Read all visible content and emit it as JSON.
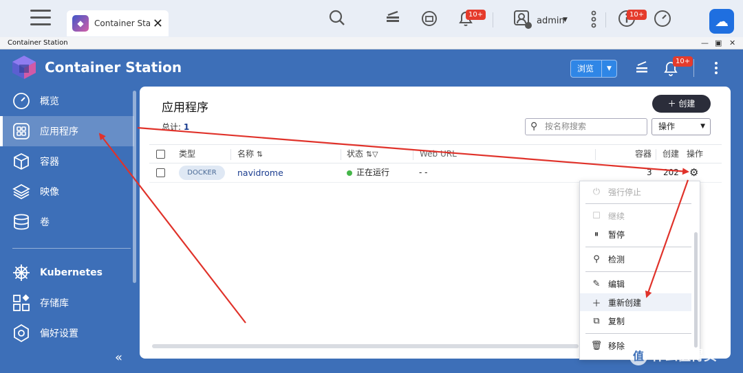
{
  "os_bar": {
    "tab_label": "Container Sta...",
    "notification_badge": "10+",
    "user_name": "admin",
    "info_badge": "10+"
  },
  "window": {
    "title": "Container Station"
  },
  "app_header": {
    "title": "Container Station",
    "browse_label": "浏览",
    "notification_badge": "10+"
  },
  "sidebar": {
    "items": [
      {
        "label": "概览",
        "icon": "gauge-icon"
      },
      {
        "label": "应用程序",
        "icon": "apps-grid-icon",
        "active": true
      },
      {
        "label": "容器",
        "icon": "cube-icon"
      },
      {
        "label": "映像",
        "icon": "layers-icon"
      },
      {
        "label": "卷",
        "icon": "database-icon"
      }
    ],
    "section2": [
      {
        "label": "Kubernetes",
        "icon": "helm-wheel-icon"
      },
      {
        "label": "存储库",
        "icon": "repository-icon"
      },
      {
        "label": "偏好设置",
        "icon": "gear-icon"
      }
    ]
  },
  "main": {
    "title": "应用程序",
    "create_label": "创建",
    "total_label": "总计:",
    "total_value": "1",
    "search_placeholder": "按名称搜索",
    "operation_label": "操作",
    "columns": {
      "type": "类型",
      "name": "名称",
      "status": "状态",
      "web_url": "Web URL",
      "containers": "容器",
      "created": "创建",
      "actions": "操作"
    },
    "rows": [
      {
        "type": "DOCKER",
        "name": "navidrome",
        "status": "正在运行",
        "web_url": "- -",
        "containers": "3",
        "created": "202"
      }
    ]
  },
  "context_menu": {
    "items": [
      {
        "label": "强行停止",
        "icon": "power-icon",
        "disabled": true
      },
      {
        "label": "继续",
        "icon": "resume-icon",
        "disabled": true
      },
      {
        "label": "暂停",
        "icon": "pause-icon"
      },
      {
        "label": "检测",
        "icon": "search-icon"
      },
      {
        "label": "编辑",
        "icon": "edit-icon"
      },
      {
        "label": "重新创建",
        "icon": "plus-icon",
        "highlighted": true
      },
      {
        "label": "复制",
        "icon": "copy-icon"
      },
      {
        "label": "移除",
        "icon": "trash-icon"
      }
    ]
  },
  "watermark": "什么值得买",
  "colors": {
    "accent": "#1f6fe0",
    "sidebar_bg": "#3d6fb8",
    "running": "#45b649",
    "annotation": "#e0322a"
  }
}
